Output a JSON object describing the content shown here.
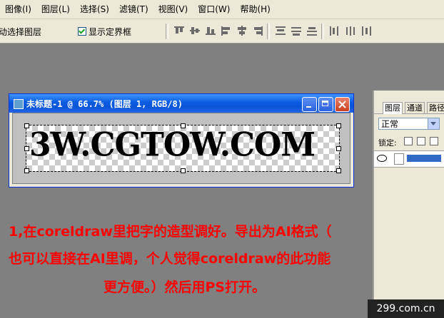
{
  "menu": {
    "items": [
      "图像(I)",
      "图层(L)",
      "选择(S)",
      "滤镜(T)",
      "视图(V)",
      "窗口(W)",
      "帮助(H)"
    ]
  },
  "options": {
    "auto_select": "动选择图层",
    "show_bounds": "显示定界框"
  },
  "document": {
    "title": "未标题-1 @ 66.7% (图层 1, RGB/8)",
    "canvas_text": "3W.CGTOW.COM"
  },
  "layers_panel": {
    "tabs": [
      "图层",
      "通道",
      "路径"
    ],
    "blend_mode": "正常",
    "lock_label": "锁定:"
  },
  "instructions": {
    "line1": "1,在coreldraw里把字的造型调好。导出为AI格式（",
    "line2": "也可以直接在AI里调，个人觉得coreldraw的此功能",
    "line3": "更方便。）然后用PS打开。"
  },
  "watermark": "299.com.cn",
  "colors": {
    "title_bar": "#0a5be0",
    "instruction_text": "#ff0000",
    "workspace": "#808080"
  }
}
